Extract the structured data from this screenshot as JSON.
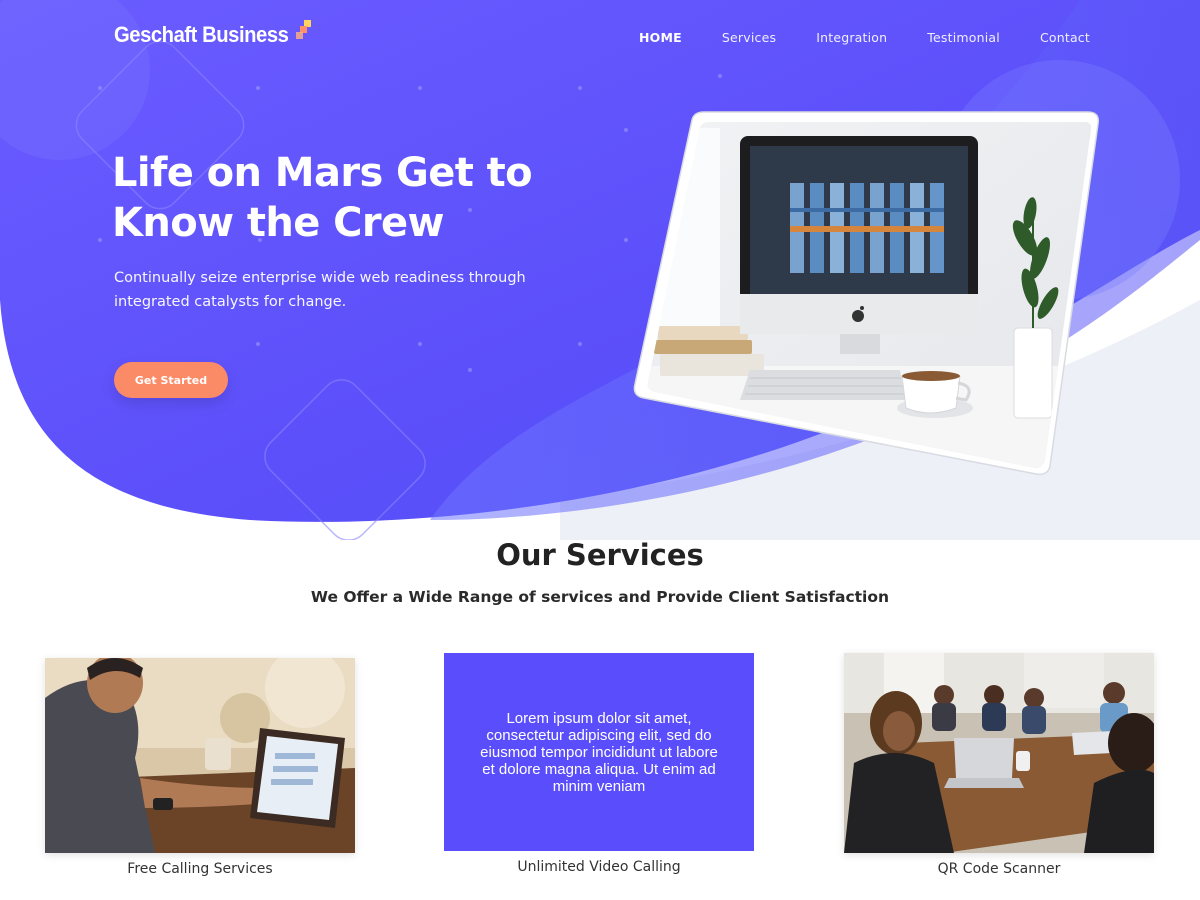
{
  "brand": {
    "name": "Geschaft Business"
  },
  "nav": {
    "items": [
      {
        "label": "HOME",
        "active": true
      },
      {
        "label": "Services",
        "active": false
      },
      {
        "label": "Integration",
        "active": false
      },
      {
        "label": "Testimonial",
        "active": false
      },
      {
        "label": "Contact",
        "active": false
      }
    ]
  },
  "hero": {
    "title": "Life on Mars Get to Know the Crew",
    "subtitle": "Continually seize enterprise wide web readiness through integrated catalysts for change.",
    "cta_label": "Get Started"
  },
  "services": {
    "title": "Our Services",
    "subtitle": "We Offer a Wide Range of services and Provide Client Satisfaction",
    "cards": [
      {
        "caption": "Free Calling Services"
      },
      {
        "caption": "Unlimited Video Calling",
        "body": "Lorem ipsum dolor sit amet, consectetur adipiscing elit, sed do eiusmod tempor incididunt ut labore et dolore magna aliqua. Ut enim ad minim veniam"
      },
      {
        "caption": "QR Code Scanner"
      }
    ]
  },
  "colors": {
    "hero_primary": "#5b4ffa",
    "hero_secondary": "#6f6cff",
    "accent": "#fb8a66",
    "card_purple": "#5a4efc"
  },
  "icons": [
    "apple-logo-icon",
    "logo-mark-icon"
  ]
}
